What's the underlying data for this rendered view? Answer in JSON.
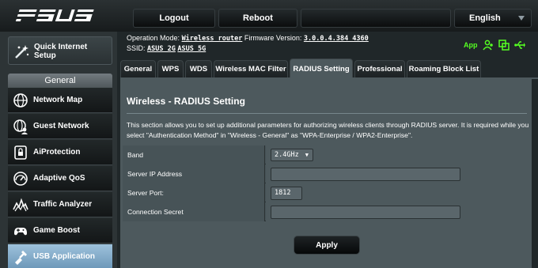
{
  "brand": "ASUS",
  "topbar": {
    "logout": "Logout",
    "reboot": "Reboot",
    "language": "English"
  },
  "sidebar": {
    "quick_setup": "Quick Internet Setup",
    "general_header": "General",
    "items": [
      {
        "label": "Network Map",
        "icon": "globe-icon"
      },
      {
        "label": "Guest Network",
        "icon": "globe-people-icon"
      },
      {
        "label": "AiProtection",
        "icon": "lock-icon"
      },
      {
        "label": "Adaptive QoS",
        "icon": "gauge-icon"
      },
      {
        "label": "Traffic Analyzer",
        "icon": "graph-icon"
      },
      {
        "label": "Game Boost",
        "icon": "gamepad-icon"
      },
      {
        "label": "USB Application",
        "icon": "usb-icon",
        "active": true
      }
    ]
  },
  "info": {
    "operation_mode_label": "Operation Mode:",
    "operation_mode_value": "Wireless router",
    "firmware_label": "Firmware Version:",
    "firmware_value": "3.0.0.4.384_4360",
    "ssid_label": "SSID:",
    "ssid_2g": "ASUS_2G",
    "ssid_5g": "ASUS_5G",
    "app_label": "App",
    "status_color": "#55ff22"
  },
  "tabs": [
    {
      "label": "General"
    },
    {
      "label": "WPS"
    },
    {
      "label": "WDS"
    },
    {
      "label": "Wireless MAC Filter"
    },
    {
      "label": "RADIUS Setting",
      "active": true
    },
    {
      "label": "Professional"
    },
    {
      "label": "Roaming Block List"
    }
  ],
  "main": {
    "title": "Wireless - RADIUS Setting",
    "description": "This section allows you to set up additional parameters for authorizing wireless clients through RADIUS server. It is required while you select \"Authentication Method\" in \"Wireless - General\" as \"WPA-Enterprise / WPA2-Enterprise\".",
    "fields": {
      "band_label": "Band",
      "band_value": "2.4GHz",
      "server_ip_label": "Server IP Address",
      "server_ip_value": "",
      "server_port_label": "Server Port:",
      "server_port_value": "1812",
      "secret_label": "Connection Secret",
      "secret_value": ""
    },
    "apply_label": "Apply"
  }
}
